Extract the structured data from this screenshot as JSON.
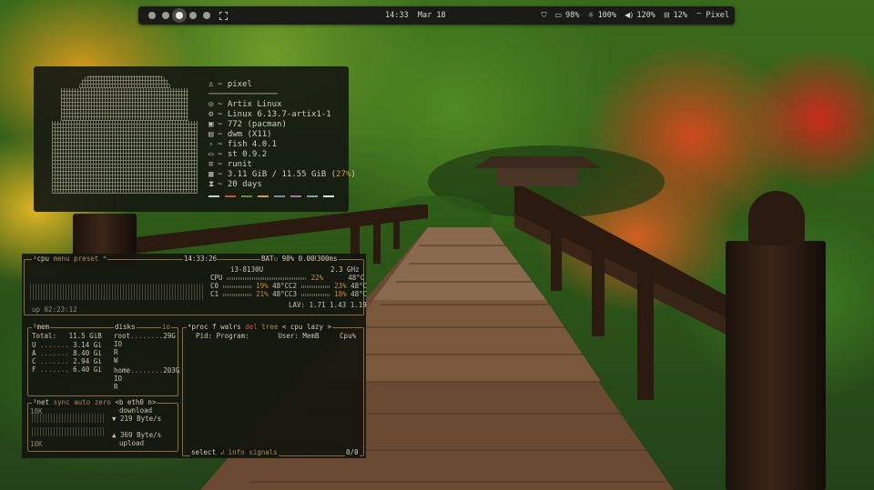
{
  "topbar": {
    "time": "14:33",
    "date": "Mar 18",
    "shield_icon": "shield-icon",
    "battery": "98%",
    "brightness": "100%",
    "volume": "120%",
    "storage": "12%",
    "wifi": "Pixel"
  },
  "fastfetch": {
    "user": "~ pixel",
    "separator": "──────────────",
    "os": "~ Artix Linux",
    "kernel": "~ Linux 6.13.7-artix1-1",
    "packages": "~ 772 (pacman)",
    "wm": "~ dwm (X11)",
    "shell": "~ fish 4.0.1",
    "terminal": "~ st 0.9.2",
    "init": "~ runit",
    "memory": "~ 3.11 GiB / 11.55 GiB (",
    "memory_pct": "27%",
    "memory_end": ")",
    "uptime": "~ 20 days",
    "palette": [
      "#cfcfc3",
      "#c9543a",
      "#6d8a3c",
      "#c9a03c",
      "#7a8a9a",
      "#a07a9a",
      "#7aa0a0",
      "#e8e8e0"
    ]
  },
  "btop": {
    "cpu_box": {
      "title": "¹cpu",
      "menu": "menu",
      "preset": "preset *",
      "clock": "14:33:26",
      "battery": "BAT▫ 98% 0.00W",
      "interval": "300ms",
      "uptime": "up 02:23:12",
      "model": "i3-8130U",
      "freq": "2.3 GHz",
      "cpu_label": "CPU",
      "cpu_pct": "22%",
      "cpu_temp": "48°C",
      "cores": [
        {
          "name": "C0",
          "pct": "19%",
          "temp": "48°C"
        },
        {
          "name": "C1",
          "pct": "21%",
          "temp": "48°C"
        },
        {
          "name": "C2",
          "pct": "23%",
          "temp": "48°C"
        },
        {
          "name": "C3",
          "pct": "18%",
          "temp": "48°C"
        }
      ],
      "lav": "LAV: 1.71 1.43 1.19"
    },
    "mem_box": {
      "title": "²mem",
      "total": "Total:   11.5 GiB",
      "rows": [
        {
          "label": "U",
          "value": "3.14 Gi"
        },
        {
          "label": "A",
          "value": "8.40 Gi"
        },
        {
          "label": "C",
          "value": "2.94 Gi"
        },
        {
          "label": "F",
          "value": "6.40 Gi"
        }
      ],
      "disks_title": "disks",
      "io_label": "io",
      "root": "root",
      "root_size": "29G",
      "home": "home",
      "home_size": "203G",
      "io": "IO",
      "r": "R",
      "w": "W"
    },
    "net_box": {
      "title": "³net",
      "sync": "sync",
      "auto": "auto",
      "zero": "zero",
      "iface": "<b eth0 n>",
      "scale_top": "10K",
      "scale_bottom": "10K",
      "download": "download",
      "down_rate": "▼ 219 Byte/s",
      "up_rate": "▲ 369 Byte/s",
      "upload": "upload"
    },
    "proc_box": {
      "title": "⁴proc",
      "filter": "f walrs",
      "del": "del",
      "tree": "tree",
      "sort": "< cpu lazy >",
      "header_pid": "Pid:",
      "header_program": "Program:",
      "header_user": "User:",
      "header_mem": "MemB",
      "header_cpu": "Cpu%",
      "footer_select": "select",
      "footer_info": "↲ info",
      "footer_signals": "signals",
      "footer_count": "0/0"
    }
  }
}
